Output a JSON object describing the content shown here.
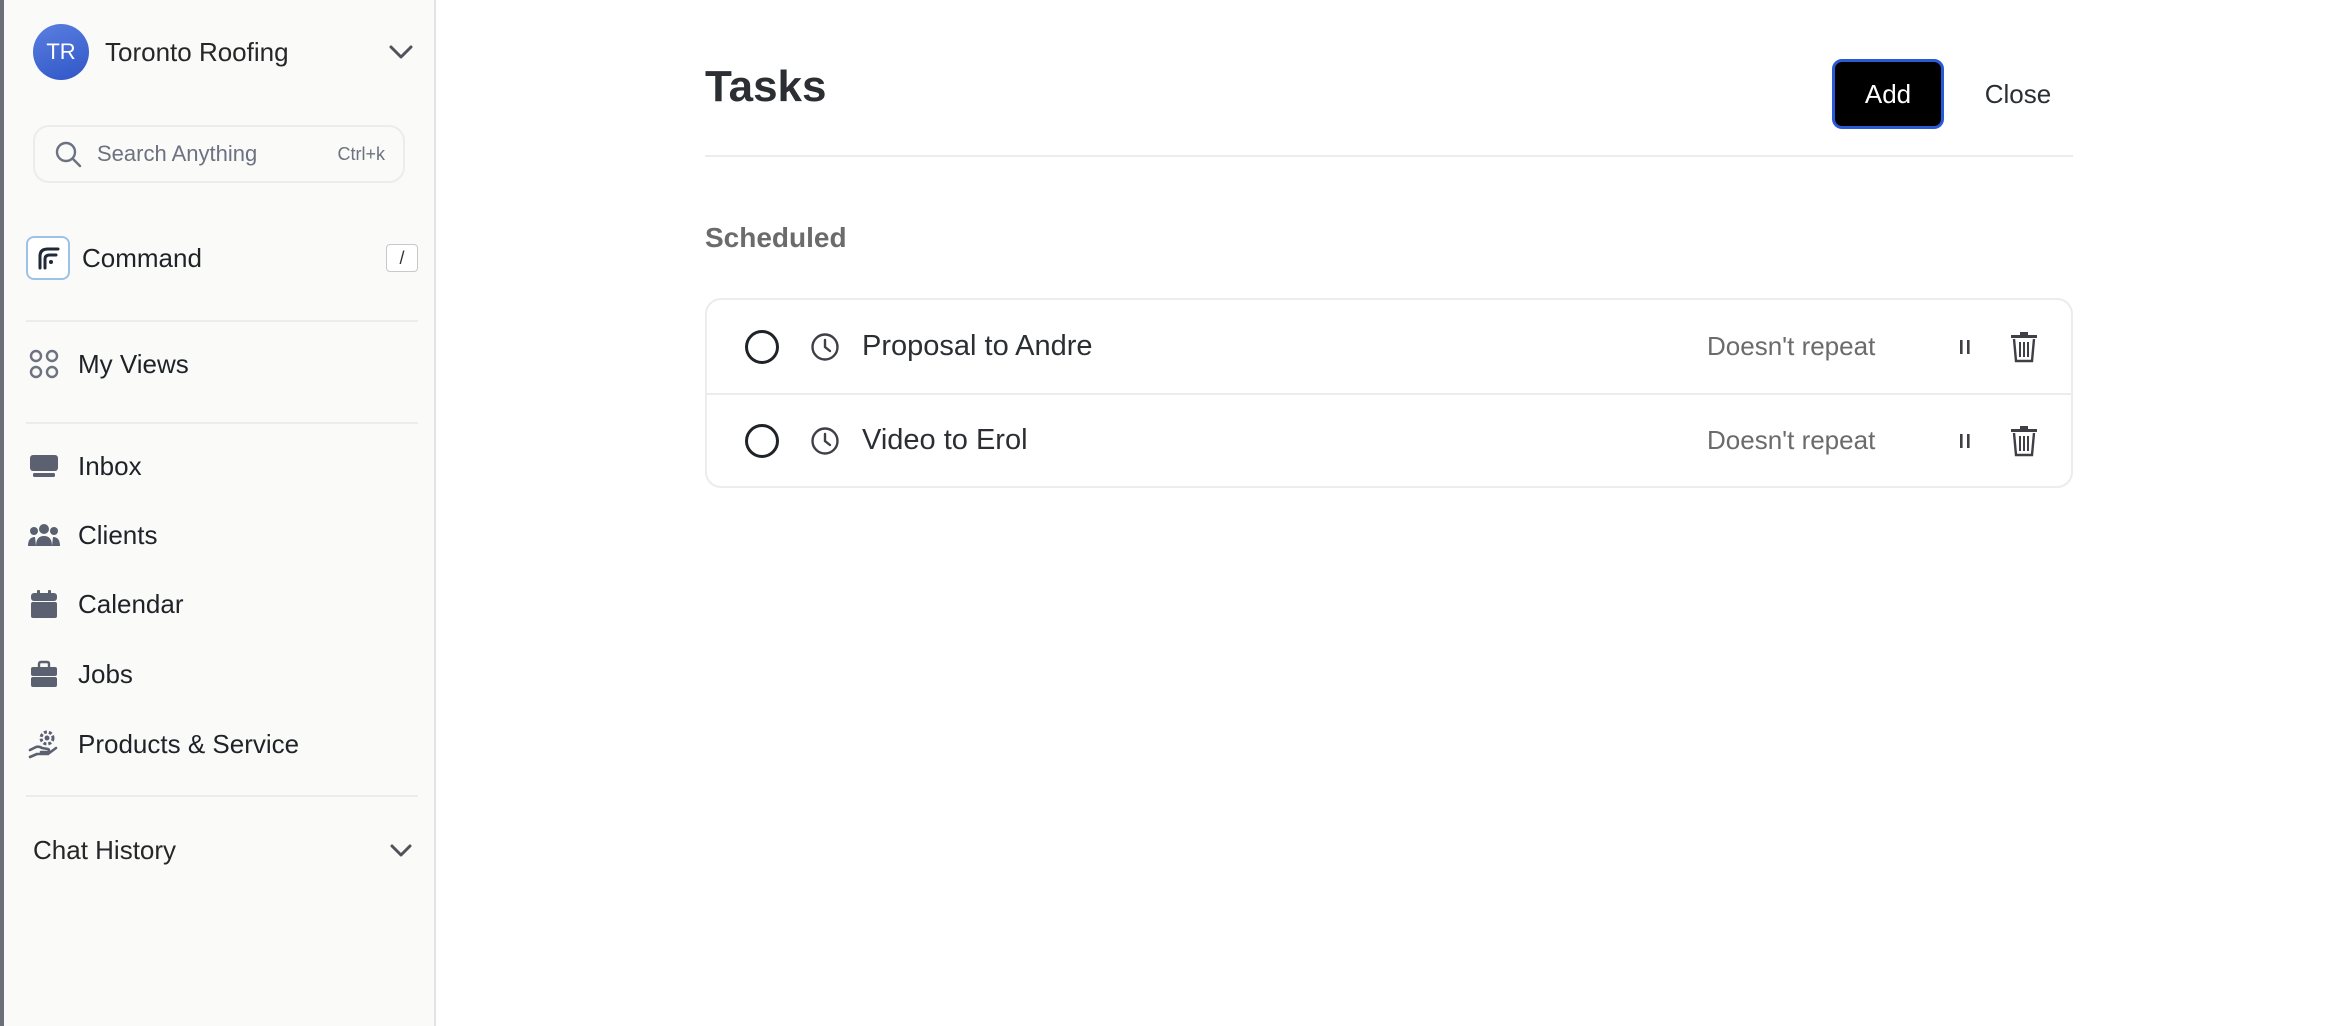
{
  "sidebar": {
    "org": {
      "initials": "TR",
      "name": "Toronto Roofing"
    },
    "search": {
      "placeholder": "Search Anything",
      "shortcut": "Ctrl+k"
    },
    "command": {
      "label": "Command",
      "shortcut": "/"
    },
    "my_views": {
      "label": "My Views"
    },
    "nav": [
      {
        "label": "Inbox",
        "icon": "inbox-icon"
      },
      {
        "label": "Clients",
        "icon": "users-icon"
      },
      {
        "label": "Calendar",
        "icon": "calendar-icon"
      },
      {
        "label": "Jobs",
        "icon": "briefcase-icon"
      },
      {
        "label": "Products & Service",
        "icon": "hand-gear-icon"
      }
    ],
    "chat_history": {
      "label": "Chat History"
    }
  },
  "main": {
    "title": "Tasks",
    "add_label": "Add",
    "close_label": "Close",
    "section_label": "Scheduled",
    "tasks": [
      {
        "name": "Proposal to Andre",
        "repeat": "Doesn't repeat"
      },
      {
        "name": "Video to Erol",
        "repeat": "Doesn't repeat"
      }
    ]
  },
  "colors": {
    "accent": "#2a5bd7",
    "avatar": "#3b63d4",
    "sidebar_bg": "#fafaf9",
    "primary_button": "#000000"
  }
}
